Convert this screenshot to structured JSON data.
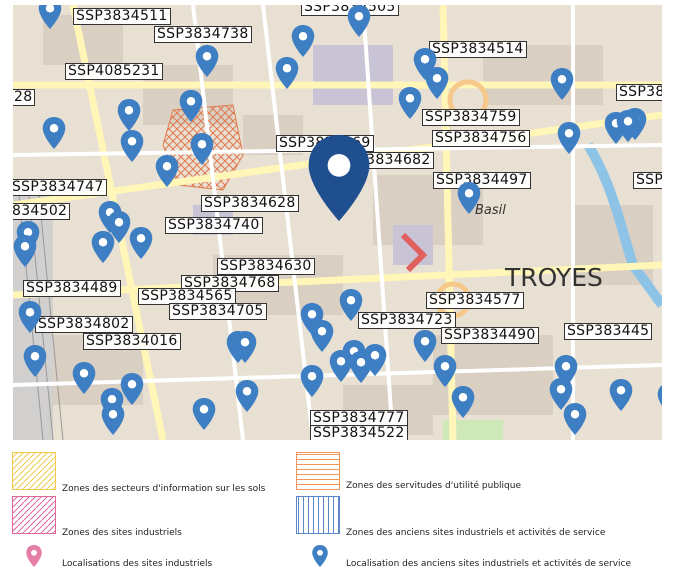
{
  "map": {
    "labels": [
      "SSP3834511",
      "SSP3834505",
      "SSP3834738",
      "SSP3834514",
      "SSP4085231",
      "28",
      "SSP38",
      "SSP3834759",
      "SSP3834756",
      "SSP3834669",
      "SSP3834682",
      "SSP3834747",
      "SSP3834497",
      "SSP",
      "834502",
      "SSP3834628",
      "SSP3834740",
      "SSP3834630",
      "SSP3834768",
      "SSP3834489",
      "SSP3834565",
      "SSP3834705",
      "SSP3834577",
      "SSP3834802",
      "SSP3834723",
      "SSP3834490",
      "SSP383445",
      "SSP3834016",
      "SSP3834777",
      "SSP3834522"
    ],
    "places": {
      "city": "TROYES",
      "district": "Basil"
    },
    "colors": {
      "pin": "#3e7fc4",
      "selected_pin": "#1f4f8f",
      "hatch": "#e07a4f"
    }
  },
  "legend": {
    "items": [
      {
        "label": "Zones des secteurs d'information sur les sols",
        "icon": "yellow-hatch-swatch",
        "color": "#f2c94c"
      },
      {
        "label": "Zones des servitudes d'utilité publique",
        "icon": "orange-lines-swatch",
        "color": "#f0955c"
      },
      {
        "label": "Zones des sites industriels",
        "icon": "pink-hatch-swatch",
        "color": "#e0659a"
      },
      {
        "label": "Zones des anciens sites industriels et activités de service",
        "icon": "blue-vertical-swatch",
        "color": "#5b86c9"
      },
      {
        "label": "Localisations des sites industriels",
        "icon": "pink-pin-icon",
        "color": "#e57fa8"
      },
      {
        "label": "Localisation des anciens sites industriels et activités de service",
        "icon": "blue-pin-icon",
        "color": "#3e7fc4"
      }
    ]
  }
}
